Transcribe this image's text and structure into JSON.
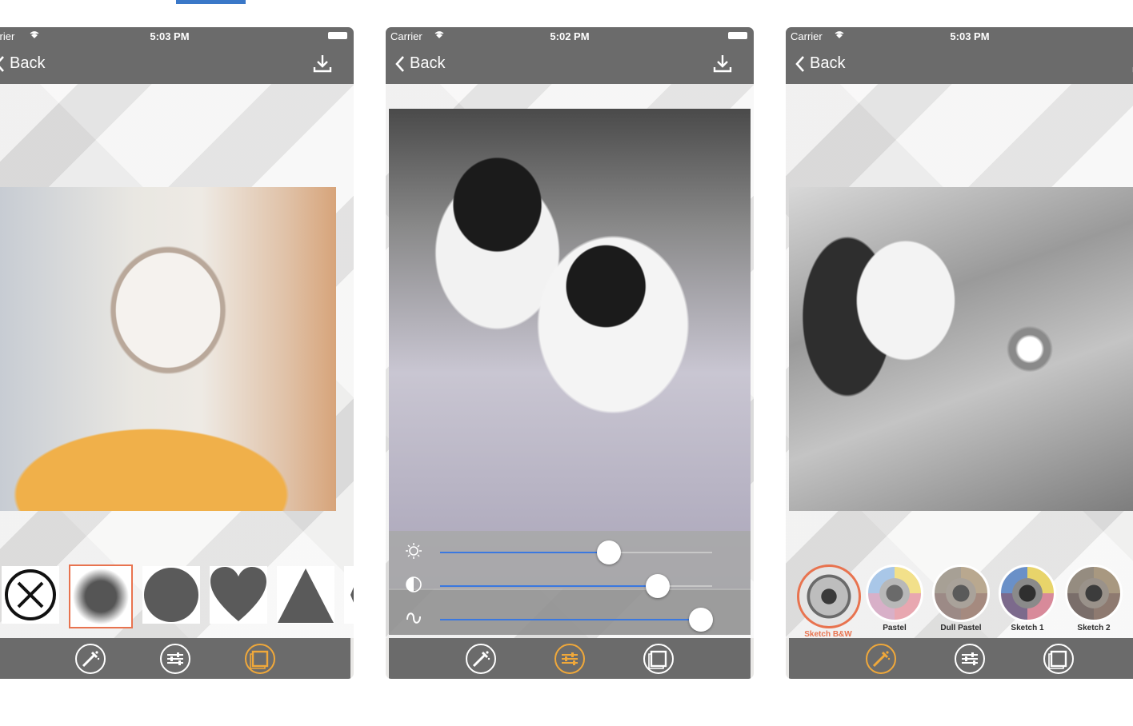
{
  "phones": [
    {
      "status": {
        "carrier": "arrier",
        "time": "5:03 PM"
      },
      "nav": {
        "back_label": "Back"
      },
      "shapes": [
        "none",
        "blur",
        "circle",
        "heart",
        "triangle",
        "partial"
      ],
      "active_tab": "frame"
    },
    {
      "status": {
        "carrier": "Carrier",
        "time": "5:02 PM"
      },
      "nav": {
        "back_label": "Back"
      },
      "sliders": [
        {
          "icon": "brightness-icon",
          "value": 0.62
        },
        {
          "icon": "contrast-icon",
          "value": 0.8
        },
        {
          "icon": "curve-icon",
          "value": 0.96
        }
      ],
      "active_tab": "adjust"
    },
    {
      "status": {
        "carrier": "Carrier",
        "time": "5:03 PM"
      },
      "nav": {
        "back_label": "Back"
      },
      "filters": [
        {
          "label": "Sketch B&W",
          "selected": true
        },
        {
          "label": "Pastel",
          "selected": false
        },
        {
          "label": "Dull Pastel",
          "selected": false
        },
        {
          "label": "Sketch 1",
          "selected": false
        },
        {
          "label": "Sketch 2",
          "selected": false
        }
      ],
      "active_tab": "effects"
    }
  ],
  "colors": {
    "accent": "#e8734f",
    "tab_active": "#f0a83a",
    "bar": "#6b6b6b",
    "slider_fill": "#3a78e0"
  }
}
